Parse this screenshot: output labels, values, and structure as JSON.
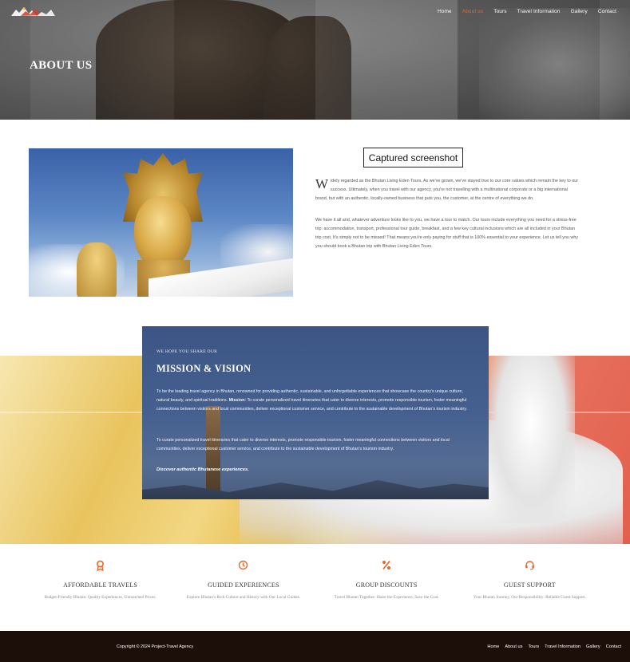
{
  "brand": {
    "accent": "#e8662a",
    "footer_bg": "#1c0f0a"
  },
  "nav": {
    "items": [
      {
        "label": "Home",
        "active": false
      },
      {
        "label": "About us",
        "active": true
      },
      {
        "label": "Tours",
        "active": false
      },
      {
        "label": "Travel Information",
        "active": false
      },
      {
        "label": "Gallery",
        "active": false
      },
      {
        "label": "Contact",
        "active": false
      }
    ]
  },
  "hero": {
    "title": "ABOUT US"
  },
  "overlay": {
    "label": "Captured screenshot"
  },
  "about": {
    "dropcap": "W",
    "p1": "idely regarded as the Bhutan Living Eden Tours, As we've grown, we've stayed true to our core values which remain the key to our success. Ultimately, when you travel with our agency, you're not travelling with a multinational corporate or a big international brand, but with an authentic, locally-owned business that puts you, the customer, at the centre of everything we do.",
    "p2": "We have it all and, whatever adventure looks like to you, we have a tour to match. Our tours include everything you need for a stress-free trip: accommodation, transport, professional tour guide, breakfast, and a few key cultural inclusions which are all included in your Bhutan trip cost. It's simply not to be missed! That means you're only paying for stuff that is 100% essential to your experience. Let us tell you why you should book a Bhutan trip with Bhutan Living Eden Tours."
  },
  "mission": {
    "eyebrow": "WE HOPE YOU SHARE OUR",
    "title": "MISSION & VISION",
    "p1_a": "To be the leading travel agency in Bhutan, renowned for providing authentic, sustainable, and unforgettable experiences that showcase the country's unique culture, natural beauty, and spiritual traditions. ",
    "p1_strong": "Mission:",
    "p1_b": " To curate personalized travel itineraries that cater to diverse interests, promote responsible tourism, foster meaningful connections between visitors and local communities, deliver exceptional customer service, and contribute to the sustainable development of Bhutan's tourism industry.",
    "p2": "To curate personalized travel itineraries that cater to diverse interests, promote responsible tourism, foster meaningful connections between visitors and local communities, deliver exceptional customer service, and contribute to the sustainable development of Bhutan's tourism industry.",
    "cta": "Discover authentic Bhutanese experiences."
  },
  "features": [
    {
      "icon": "award-icon",
      "title": "AFFORDABLE TRAVELS",
      "desc": "Budget-Friendly Bhutan: Quality Experiences, Unmatched Prices."
    },
    {
      "icon": "clock-icon",
      "title": "GUIDED EXPERIENCES",
      "desc": "Explore Bhutan's Rich Culture and History with Our Local Guides."
    },
    {
      "icon": "percent-icon",
      "title": "GROUP DISCOUNTS",
      "desc": "Travel Bhutan Together: Share the Experience, Save the Cost."
    },
    {
      "icon": "headset-icon",
      "title": "GUEST SUPPORT",
      "desc": "Your Bhutan Journey, Our Responsibility: Reliable Guest Support."
    }
  ],
  "footer": {
    "copyright": "Copyright © 2024 Project-Travel Agency",
    "nav": [
      "Home",
      "About us",
      "Tours",
      "Travel Information",
      "Gallery",
      "Contact"
    ]
  }
}
